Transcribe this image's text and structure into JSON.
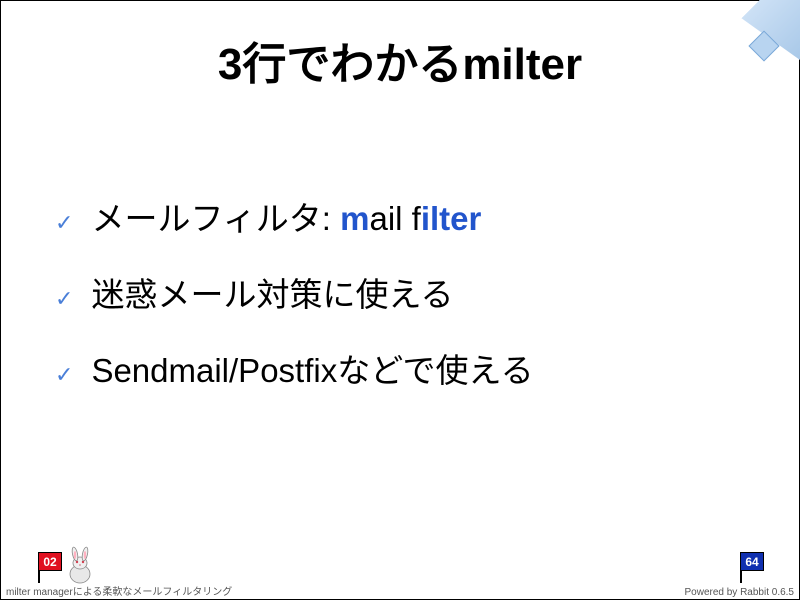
{
  "slide": {
    "title": "3行でわかるmilter",
    "bullets": [
      {
        "prefix": "メールフィルタ: ",
        "m": "m",
        "mid": "ail f",
        "ilter": "ilter"
      },
      {
        "text": "迷惑メール対策に使える"
      },
      {
        "text": "Sendmail/Postfixなどで使える"
      }
    ]
  },
  "footer": {
    "currentPage": "02",
    "totalPages": "64",
    "leftText": "milter managerによる柔軟なメールフィルタリング",
    "rightText": "Powered by Rabbit 0.6.5"
  }
}
